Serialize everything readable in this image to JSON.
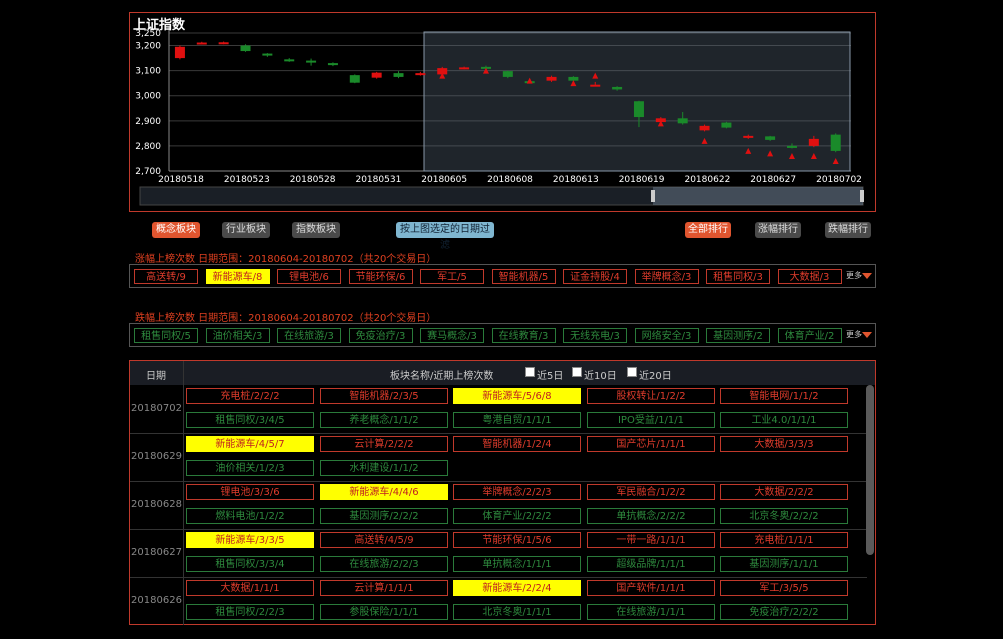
{
  "chart": {
    "title": "上证指数",
    "y_ticks": [
      "3,250",
      "3,200",
      "3,100",
      "3,000",
      "2,900",
      "2,800",
      "2,700"
    ],
    "x_ticks": [
      "20180518",
      "20180523",
      "20180528",
      "20180531",
      "20180605",
      "20180608",
      "20180613",
      "20180619",
      "20180622",
      "20180627",
      "20180702"
    ]
  },
  "chart_data": {
    "type": "candlestick",
    "ylim": [
      2700,
      3250
    ],
    "candles": [
      {
        "o": 3150,
        "c": 3195,
        "h": 3200,
        "l": 3145,
        "up": true
      },
      {
        "o": 3208,
        "c": 3212,
        "h": 3215,
        "l": 3205,
        "up": true
      },
      {
        "o": 3210,
        "c": 3213,
        "h": 3216,
        "l": 3205,
        "up": true
      },
      {
        "o": 3200,
        "c": 3178,
        "h": 3205,
        "l": 3175,
        "up": false
      },
      {
        "o": 3168,
        "c": 3160,
        "h": 3170,
        "l": 3155,
        "up": false
      },
      {
        "o": 3145,
        "c": 3140,
        "h": 3150,
        "l": 3135,
        "up": false
      },
      {
        "o": 3140,
        "c": 3136,
        "h": 3148,
        "l": 3120,
        "up": false
      },
      {
        "o": 3130,
        "c": 3122,
        "h": 3133,
        "l": 3118,
        "up": false
      },
      {
        "o": 3082,
        "c": 3052,
        "h": 3085,
        "l": 3050,
        "up": false
      },
      {
        "o": 3072,
        "c": 3092,
        "h": 3095,
        "l": 3068,
        "up": true
      },
      {
        "o": 3090,
        "c": 3075,
        "h": 3098,
        "l": 3070,
        "up": false
      },
      {
        "o": 3083,
        "c": 3090,
        "h": 3095,
        "l": 3080,
        "up": true
      },
      {
        "o": 3085,
        "c": 3110,
        "h": 3115,
        "l": 3080,
        "up": true
      },
      {
        "o": 3110,
        "c": 3113,
        "h": 3116,
        "l": 3105,
        "up": true
      },
      {
        "o": 3115,
        "c": 3108,
        "h": 3120,
        "l": 3105,
        "up": false
      },
      {
        "o": 3098,
        "c": 3075,
        "h": 3100,
        "l": 3070,
        "up": false
      },
      {
        "o": 3058,
        "c": 3055,
        "h": 3062,
        "l": 3050,
        "up": false
      },
      {
        "o": 3060,
        "c": 3075,
        "h": 3080,
        "l": 3055,
        "up": true
      },
      {
        "o": 3075,
        "c": 3060,
        "h": 3078,
        "l": 3055,
        "up": false
      },
      {
        "o": 3042,
        "c": 3044,
        "h": 3055,
        "l": 3040,
        "up": true
      },
      {
        "o": 3035,
        "c": 3025,
        "h": 3038,
        "l": 3020,
        "up": false
      },
      {
        "o": 2978,
        "c": 2915,
        "h": 2980,
        "l": 2875,
        "up": false
      },
      {
        "o": 2895,
        "c": 2910,
        "h": 2915,
        "l": 2880,
        "up": true
      },
      {
        "o": 2910,
        "c": 2890,
        "h": 2935,
        "l": 2885,
        "up": false
      },
      {
        "o": 2862,
        "c": 2880,
        "h": 2885,
        "l": 2858,
        "up": true
      },
      {
        "o": 2893,
        "c": 2873,
        "h": 2896,
        "l": 2870,
        "up": false
      },
      {
        "o": 2832,
        "c": 2840,
        "h": 2845,
        "l": 2828,
        "up": true
      },
      {
        "o": 2838,
        "c": 2824,
        "h": 2840,
        "l": 2820,
        "up": false
      },
      {
        "o": 2800,
        "c": 2795,
        "h": 2810,
        "l": 2790,
        "up": false
      },
      {
        "o": 2800,
        "c": 2828,
        "h": 2840,
        "l": 2795,
        "up": true
      },
      {
        "o": 2845,
        "c": 2780,
        "h": 2850,
        "l": 2775,
        "up": false
      }
    ],
    "markers": [
      {
        "i": 12,
        "v": 3080
      },
      {
        "i": 14,
        "v": 3100
      },
      {
        "i": 16,
        "v": 3060
      },
      {
        "i": 18,
        "v": 3050
      },
      {
        "i": 19,
        "v": 3080
      },
      {
        "i": 22,
        "v": 2890
      },
      {
        "i": 24,
        "v": 2820
      },
      {
        "i": 26,
        "v": 2780
      },
      {
        "i": 27,
        "v": 2770
      },
      {
        "i": 28,
        "v": 2760
      },
      {
        "i": 29,
        "v": 2760
      },
      {
        "i": 30,
        "v": 2740
      },
      {
        "i": 31,
        "v": 2730
      }
    ],
    "selection": {
      "from": "20180604",
      "to": "20180702"
    }
  },
  "buttons": {
    "concept": "概念板块",
    "industry": "行业板块",
    "index": "指数板块",
    "filter": "按上图选定的日期过滤",
    "all_rank": "全部排行",
    "up_rank": "涨幅排行",
    "down_rank": "跌幅排行"
  },
  "rise": {
    "label": "涨幅上榜次数  日期范围：20180604-20180702（共20个交易日）",
    "chips": [
      "高送转/9",
      "新能源车/8",
      "锂电池/6",
      "节能环保/6",
      "军工/5",
      "智能机器/5",
      "证金持股/4",
      "举牌概念/3",
      "租售同权/3",
      "大数据/3"
    ],
    "more": "更多"
  },
  "fall": {
    "label": "跌幅上榜次数  日期范围：20180604-20180702（共20个交易日）",
    "chips": [
      "租售同权/5",
      "油价相关/3",
      "在线旅游/3",
      "免疫治疗/3",
      "赛马概念/3",
      "在线教育/3",
      "无线充电/3",
      "网络安全/3",
      "基因测序/2",
      "体育产业/2"
    ],
    "more": "更多"
  },
  "table": {
    "col_date": "日期",
    "col_name": "板块名称/近期上榜次数",
    "opt5": "近5日",
    "opt10": "近10日",
    "opt20": "近20日",
    "groups": [
      {
        "date": "20180702",
        "red": [
          "充电桩/2/2/2",
          "智能机器/2/3/5",
          "新能源车/5/6/8",
          "股权转让/1/2/2",
          "智能电网/1/1/2"
        ],
        "green": [
          "租售同权/3/4/5",
          "养老概念/1/1/2",
          "粤港自贸/1/1/1",
          "IPO受益/1/1/1",
          "工业4.0/1/1/1"
        ]
      },
      {
        "date": "20180629",
        "red": [
          "新能源车/4/5/7",
          "云计算/2/2/2",
          "智能机器/1/2/4",
          "国产芯片/1/1/1",
          "大数据/3/3/3"
        ],
        "green": [
          "油价相关/1/2/3",
          "水利建设/1/1/2"
        ]
      },
      {
        "date": "20180628",
        "red": [
          "锂电池/3/3/6",
          "新能源车/4/4/6",
          "举牌概念/2/2/3",
          "军民融合/1/2/2",
          "大数据/2/2/2"
        ],
        "green": [
          "燃料电池/1/2/2",
          "基因测序/2/2/2",
          "体育产业/2/2/2",
          "单抗概念/2/2/2",
          "北京冬奥/2/2/2"
        ]
      },
      {
        "date": "20180627",
        "red": [
          "新能源车/3/3/5",
          "高送转/4/5/9",
          "节能环保/1/5/6",
          "一带一路/1/1/1",
          "充电桩/1/1/1"
        ],
        "green": [
          "租售同权/3/3/4",
          "在线旅游/2/2/3",
          "单抗概念/1/1/1",
          "超级品牌/1/1/1",
          "基因测序/1/1/1"
        ]
      },
      {
        "date": "20180626",
        "red": [
          "大数据/1/1/1",
          "云计算/1/1/1",
          "新能源车/2/2/4",
          "国产软件/1/1/1",
          "军工/3/5/5"
        ],
        "green": [
          "租售同权/2/2/3",
          "参股保险/1/1/1",
          "北京冬奥/1/1/1",
          "在线旅游/1/1/1",
          "免疫治疗/2/2/2"
        ]
      }
    ]
  }
}
